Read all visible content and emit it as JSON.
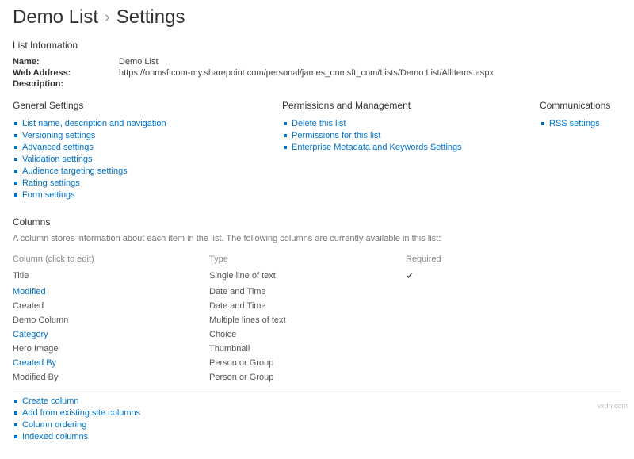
{
  "breadcrumb": {
    "list_name": "Demo List",
    "page": "Settings"
  },
  "list_info": {
    "heading": "List Information",
    "name_label": "Name:",
    "name_value": "Demo List",
    "web_label": "Web Address:",
    "web_value": "https://onmsftcom-my.sharepoint.com/personal/james_onmsft_com/Lists/Demo List/AllItems.aspx",
    "desc_label": "Description:",
    "desc_value": ""
  },
  "general": {
    "heading": "General Settings",
    "items": [
      "List name, description and navigation",
      "Versioning settings",
      "Advanced settings",
      "Validation settings",
      "Audience targeting settings",
      "Rating settings",
      "Form settings"
    ]
  },
  "permissions": {
    "heading": "Permissions and Management",
    "items": [
      "Delete this list",
      "Permissions for this list",
      "Enterprise Metadata and Keywords Settings"
    ]
  },
  "communications": {
    "heading": "Communications",
    "items": [
      "RSS settings"
    ]
  },
  "columns_section": {
    "heading": "Columns",
    "description": "A column stores information about each item in the list. The following columns are currently available in this list:",
    "header_name": "Column (click to edit)",
    "header_type": "Type",
    "header_required": "Required",
    "rows": [
      {
        "name": "Title",
        "link": false,
        "type": "Single line of text",
        "required": true
      },
      {
        "name": "Modified",
        "link": true,
        "type": "Date and Time",
        "required": false
      },
      {
        "name": "Created",
        "link": false,
        "type": "Date and Time",
        "required": false
      },
      {
        "name": "Demo Column",
        "link": false,
        "type": "Multiple lines of text",
        "required": false
      },
      {
        "name": "Category",
        "link": true,
        "type": "Choice",
        "required": false
      },
      {
        "name": "Hero Image",
        "link": false,
        "type": "Thumbnail",
        "required": false
      },
      {
        "name": "Created By",
        "link": true,
        "type": "Person or Group",
        "required": false
      },
      {
        "name": "Modified By",
        "link": false,
        "type": "Person or Group",
        "required": false
      }
    ]
  },
  "column_actions": {
    "items": [
      "Create column",
      "Add from existing site columns",
      "Column ordering",
      "Indexed columns"
    ]
  },
  "watermark": "vxdn.com"
}
